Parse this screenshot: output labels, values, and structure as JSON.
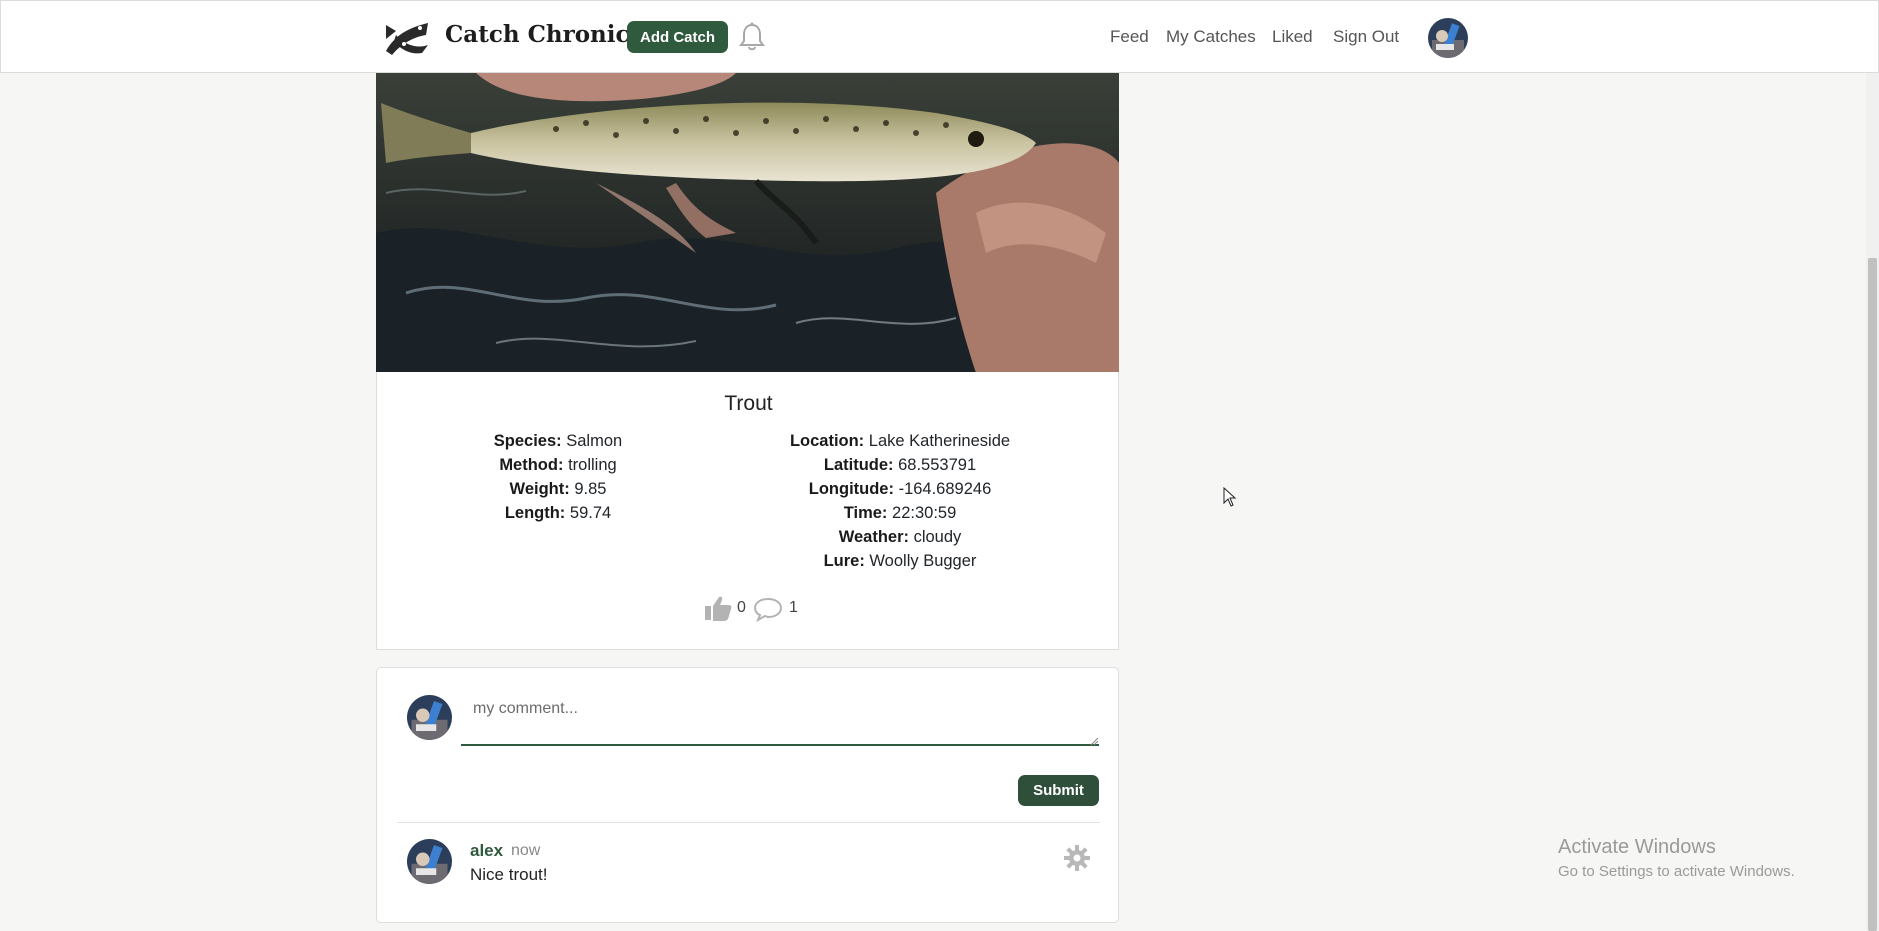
{
  "navbar": {
    "brand_name": "Catch Chronicle",
    "add_catch_label": "Add Catch",
    "links": [
      "Feed",
      "My Catches",
      "Liked",
      "Sign Out"
    ]
  },
  "catch": {
    "title": "Trout",
    "left_details": [
      {
        "label": "Species:",
        "value": "Salmon"
      },
      {
        "label": "Method:",
        "value": "trolling"
      },
      {
        "label": "Weight:",
        "value": "9.85"
      },
      {
        "label": "Length:",
        "value": "59.74"
      }
    ],
    "right_details": [
      {
        "label": "Location:",
        "value": "Lake Katherineside"
      },
      {
        "label": "Latitude:",
        "value": "68.553791"
      },
      {
        "label": "Longitude:",
        "value": "-164.689246"
      },
      {
        "label": "Time:",
        "value": "22:30:59"
      },
      {
        "label": "Weather:",
        "value": "cloudy"
      },
      {
        "label": "Lure:",
        "value": "Woolly Bugger"
      }
    ],
    "likes": "0",
    "comments_count": "1"
  },
  "comment_form": {
    "placeholder": "my comment...",
    "value": "",
    "submit_label": "Submit"
  },
  "comments": [
    {
      "author": "alex",
      "time": "now",
      "text": "Nice trout!"
    }
  ],
  "watermark": {
    "title": "Activate Windows",
    "subtitle": "Go to Settings to activate Windows."
  },
  "colors": {
    "accent": "#2f5a3e",
    "page_bg": "#f6f6f5"
  }
}
